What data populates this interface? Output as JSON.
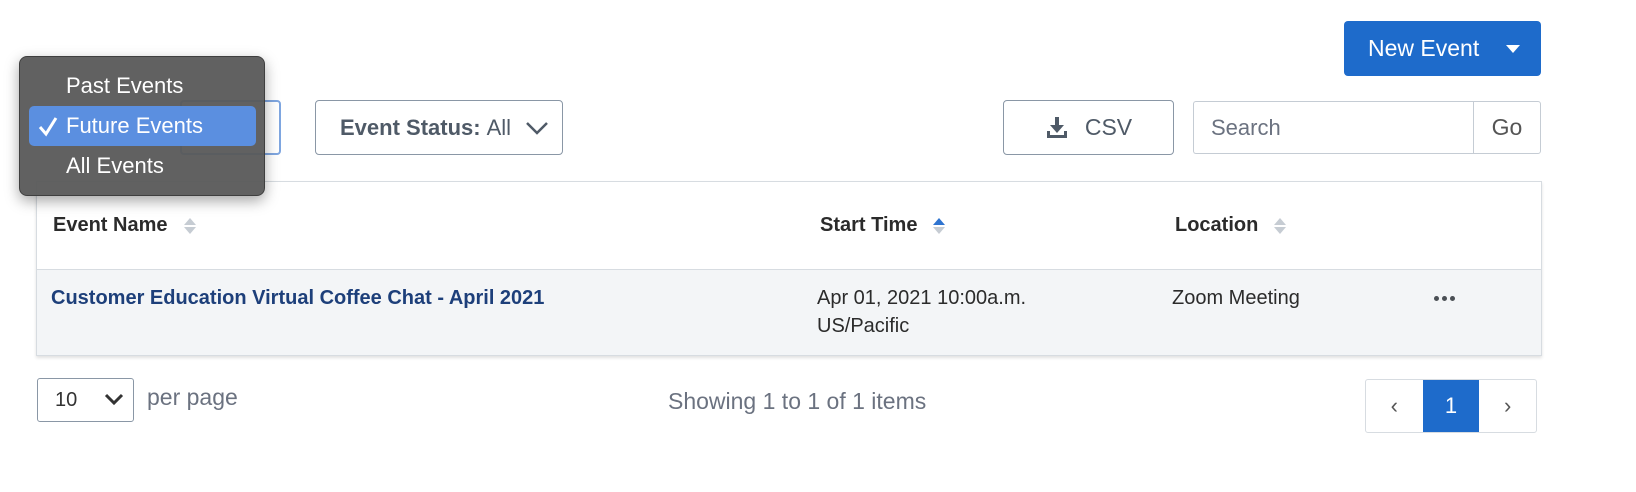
{
  "toolbar": {
    "new_event_label": "New Event",
    "event_status_label": "Event Status:",
    "event_status_value": "All",
    "csv_label": "CSV",
    "search_placeholder": "Search",
    "go_label": "Go"
  },
  "time_filter": {
    "options": [
      "Past Events",
      "Future Events",
      "All Events"
    ],
    "selected": "Future Events"
  },
  "table": {
    "columns": {
      "event_name": "Event Name",
      "start_time": "Start Time",
      "location": "Location"
    },
    "rows": [
      {
        "event_name": "Customer Education Virtual Coffee Chat - April 2021",
        "start_time_line1": "Apr 01, 2021 10:00a.m.",
        "start_time_line2": "US/Pacific",
        "location": "Zoom Meeting"
      }
    ]
  },
  "footer": {
    "per_page_value": "10",
    "per_page_label": "per page",
    "showing_text": "Showing 1 to 1 of 1 items",
    "pagination": {
      "prev": "‹",
      "current": "1",
      "next": "›"
    }
  },
  "colors": {
    "primary": "#1e6bcb",
    "link": "#1d3f7a",
    "dropdown_selected": "#5b8fe0"
  }
}
